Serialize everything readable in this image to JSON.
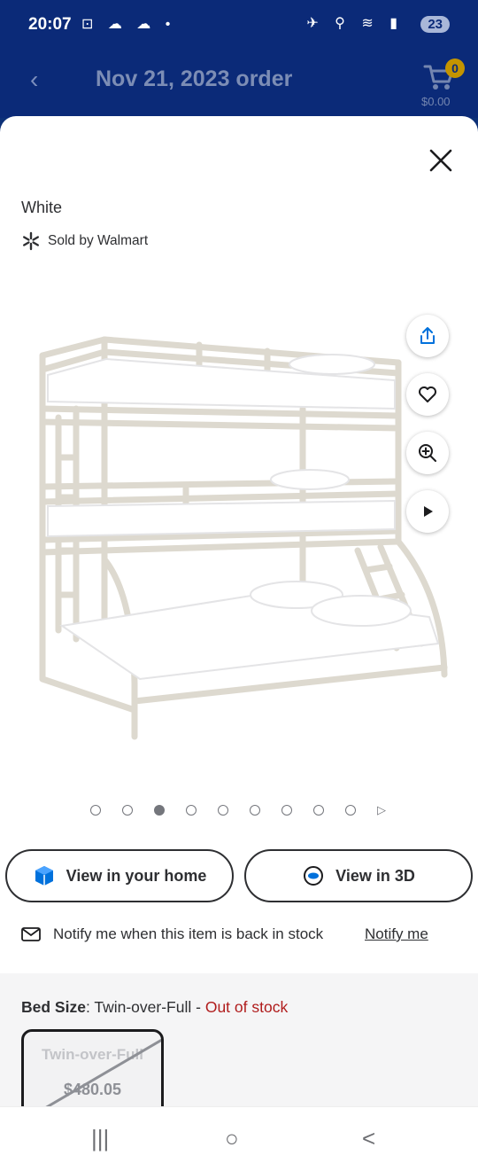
{
  "status_bar": {
    "time": "20:07",
    "left_icons": "⊡ ☁ ☁ •",
    "right_icons": "✈ ⚲ ≋ ▮",
    "battery": "23"
  },
  "app_bar": {
    "back_icon": "chevron-left-icon",
    "title": "Nov 21, 2023 order",
    "cart_count": "0",
    "cart_total": "$0.00"
  },
  "sheet": {
    "variant": "White",
    "seller": "Sold by Walmart",
    "side_actions": [
      "share-icon",
      "heart-icon",
      "zoom-icon",
      "play-icon"
    ],
    "carousel": {
      "total_dots": 9,
      "active_index": 2,
      "next_icon": "▷"
    },
    "buttons": {
      "view_in_home": "View in your home",
      "view_in_3d": "View in 3D"
    },
    "notify": {
      "text": "Notify me when this item is back in stock",
      "link": "Notify me"
    },
    "bed_size": {
      "label": "Bed Size",
      "separator": ":",
      "value": " Twin-over-Full",
      "dash": " - ",
      "status": "Out of stock",
      "option_name": "Twin-over-Full",
      "option_price": "$480.05"
    },
    "colors": {
      "brand_blue": "#0b2a78",
      "cart_badge": "#c49400",
      "spark_blue": "#0071dc",
      "out_of_stock_red": "#b01c1c"
    }
  },
  "nav_bar": {
    "recents": "|||",
    "home": "○",
    "back": "<"
  }
}
